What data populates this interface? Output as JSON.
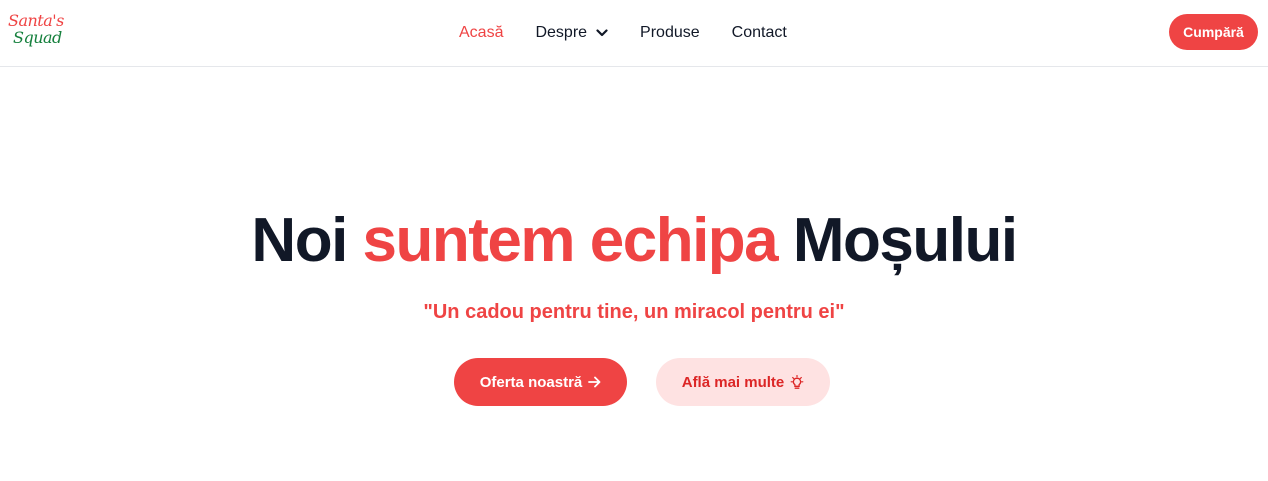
{
  "logo": {
    "line1": "Santa's",
    "line2": "Squad"
  },
  "nav": {
    "items": [
      {
        "label": "Acasă",
        "active": true
      },
      {
        "label": "Despre",
        "icon": "chevron-down-icon"
      },
      {
        "label": "Produse"
      },
      {
        "label": "Contact"
      }
    ],
    "cta_label": "Cumpără"
  },
  "hero": {
    "title_part1": "Noi ",
    "title_accent": "suntem echipa",
    "title_part2": " Moșului",
    "tagline": "\"Un cadou pentru tine, un miracol pentru ei\"",
    "primary_button": {
      "label": "Oferta noastră",
      "icon": "arrow-right-icon"
    },
    "secondary_button": {
      "label": "Află mai multe",
      "icon": "lightbulb-icon"
    }
  },
  "colors": {
    "accent": "#ef4444",
    "text_dark": "#111827",
    "logo_green": "#15803d",
    "secondary_bg": "#fee2e2"
  }
}
